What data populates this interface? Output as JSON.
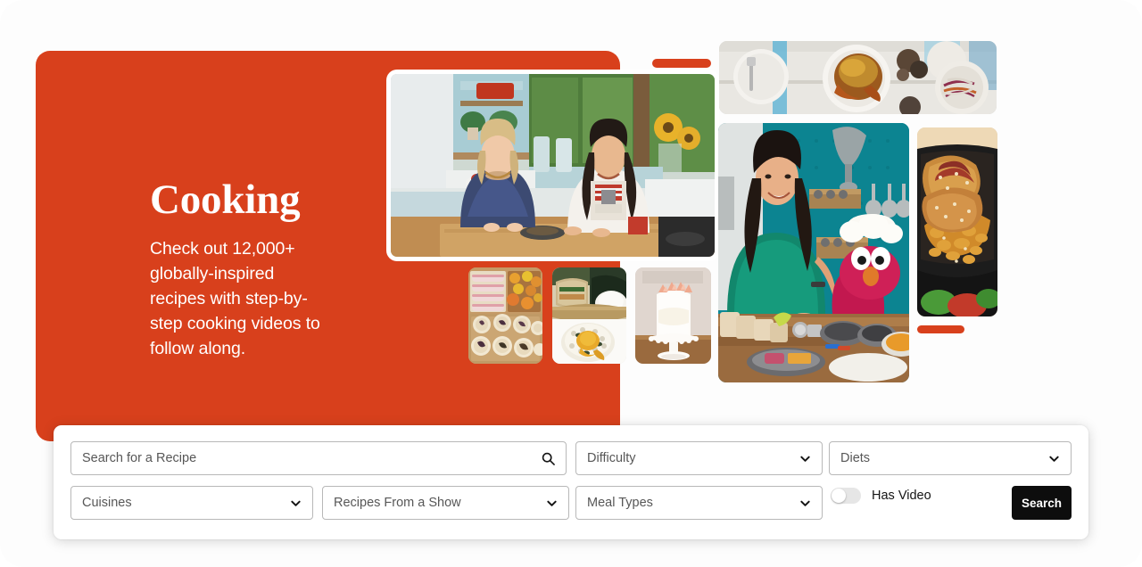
{
  "theme": {
    "brand_orange": "#d8401c",
    "card_background": "#ffffff",
    "button_black": "#0d0d0d",
    "field_border": "#b8b8b8",
    "toggle_track": "#e6e6e6"
  },
  "hero": {
    "title": "Cooking",
    "subtitle": "Check out 12,000+ globally-inspired recipes with step-by-step cooking videos to follow along."
  },
  "collage": {
    "tiles": [
      {
        "name": "hero-kitchen-hosts",
        "alt": "Two hosts laughing together at a kitchen island"
      },
      {
        "name": "top-plated-food",
        "alt": "Overhead of roast chicken, fork on plate and slaw bowl"
      },
      {
        "name": "chef-with-puppet",
        "alt": "Host in green top preparing food beside a red puppet in chef hat"
      },
      {
        "name": "fried-chicken-bowl",
        "alt": "Fried chicken over noodles in a black bowl"
      },
      {
        "name": "bento-cookies",
        "alt": "Wooden bento box of decorated shortbread cookies"
      },
      {
        "name": "sushi-onigiri",
        "alt": "Onigiri and sandwiches with soft-boiled egg"
      },
      {
        "name": "frosted-cake",
        "alt": "White frosted layer cake on a pedestal stand"
      }
    ],
    "accent_pills": 2
  },
  "search": {
    "recipe_input": {
      "placeholder": "Search for a Recipe",
      "value": ""
    },
    "selects": [
      {
        "name": "difficulty",
        "label": "Difficulty"
      },
      {
        "name": "diets",
        "label": "Diets"
      },
      {
        "name": "cuisines",
        "label": "Cuisines"
      },
      {
        "name": "recipes-from-a-show",
        "label": "Recipes From a Show"
      },
      {
        "name": "meal-types",
        "label": "Meal Types"
      }
    ],
    "has_video": {
      "label": "Has Video",
      "enabled": false
    },
    "submit_label": "Search"
  }
}
